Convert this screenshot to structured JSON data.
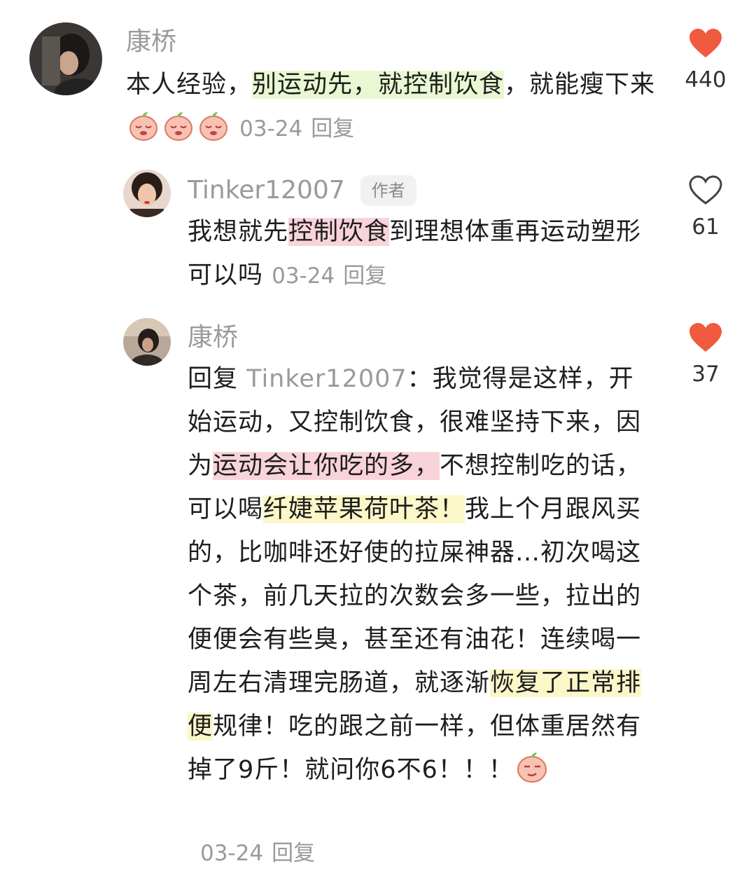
{
  "comments": [
    {
      "username": "康桥",
      "text_parts": [
        "本人经验，",
        "别运动先，就控制饮食",
        "，就能瘦下来"
      ],
      "date": "03-24",
      "reply_label": "回复",
      "likes": "440",
      "liked": true,
      "emoji_count": 3,
      "emoji_icon": "peach-sad-face-icon"
    },
    {
      "username": "Tinker12007",
      "author_tag": "作者",
      "text_parts": [
        "我想就先",
        "控制饮食",
        "到理想体重再运动塑形可以吗"
      ],
      "date": "03-24",
      "reply_label": "回复",
      "likes": "61",
      "liked": false
    },
    {
      "username": "康桥",
      "reply_prefix": "回复",
      "reply_to": "Tinker12007",
      "text_parts": [
        "：我觉得是这样，开始运动，又控制饮食，很难坚持下来，因为",
        "运动会让你吃的多，",
        "不想控制吃的话，可以喝",
        "纤婕苹果荷叶茶！",
        "我上个月跟风买的，比咖啡还好使的拉屎神器…初次喝这个茶，前几天拉的次数会多一些，拉出的便便会有些臭，甚至还有油花！连续喝一周左右清理完肠道，就逐渐",
        "恢复了正常排便",
        "规律！吃的跟之前一样，但体重居然有掉了9斤！就问你6不6！！！"
      ],
      "emoji_icon": "peach-smirk-face-icon",
      "date": "03-24",
      "reply_label": "回复",
      "likes": "37",
      "liked": true
    }
  ],
  "colors": {
    "heart_red": "#f05a3f",
    "meta_gray": "#9a9a9a"
  }
}
